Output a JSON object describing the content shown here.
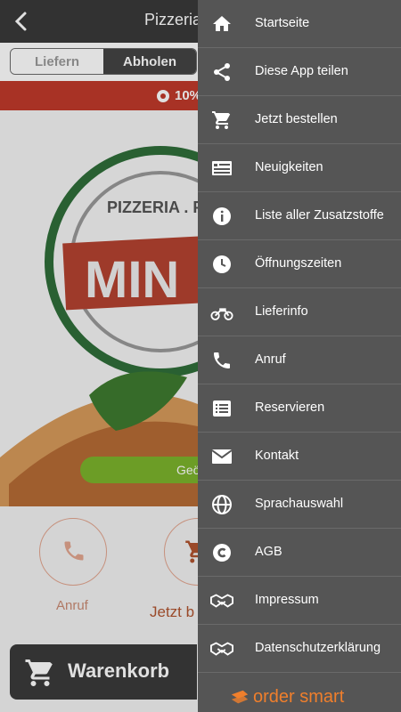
{
  "header": {
    "title": "Pizzeria"
  },
  "order_mode": {
    "deliver_label": "Liefern",
    "pickup_label": "Abholen"
  },
  "promo": {
    "text": "10%"
  },
  "hero": {
    "logo_text": "MIN",
    "ring_text": "PIZZERIA . PIZZ",
    "geo_button_text": "Geö"
  },
  "actions": {
    "call_label": "Anruf",
    "order_label": "Jetzt b"
  },
  "cart": {
    "label": "Warenkorb"
  },
  "menu": {
    "items": [
      {
        "label": "Startseite",
        "icon": "home-icon"
      },
      {
        "label": "Diese App teilen",
        "icon": "share-icon"
      },
      {
        "label": "Jetzt bestellen",
        "icon": "cart-icon"
      },
      {
        "label": "Neuigkeiten",
        "icon": "news-icon"
      },
      {
        "label": "Liste aller Zusatzstoffe",
        "icon": "info-icon"
      },
      {
        "label": "Öffnungszeiten",
        "icon": "clock-icon"
      },
      {
        "label": "Lieferinfo",
        "icon": "motorcycle-icon"
      },
      {
        "label": "Anruf",
        "icon": "phone-icon"
      },
      {
        "label": "Reservieren",
        "icon": "list-icon"
      },
      {
        "label": "Kontakt",
        "icon": "mail-icon"
      },
      {
        "label": "Sprachauswahl",
        "icon": "globe-icon"
      },
      {
        "label": "AGB",
        "icon": "copyright-icon"
      },
      {
        "label": "Impressum",
        "icon": "handshake-icon"
      },
      {
        "label": "Datenschutzerklärung",
        "icon": "handshake-icon"
      }
    ],
    "brand": "order smart"
  },
  "colors": {
    "accent": "#c0392b",
    "drawer": "#555555",
    "green": "#7cb32c",
    "brand": "#f07f2c"
  }
}
